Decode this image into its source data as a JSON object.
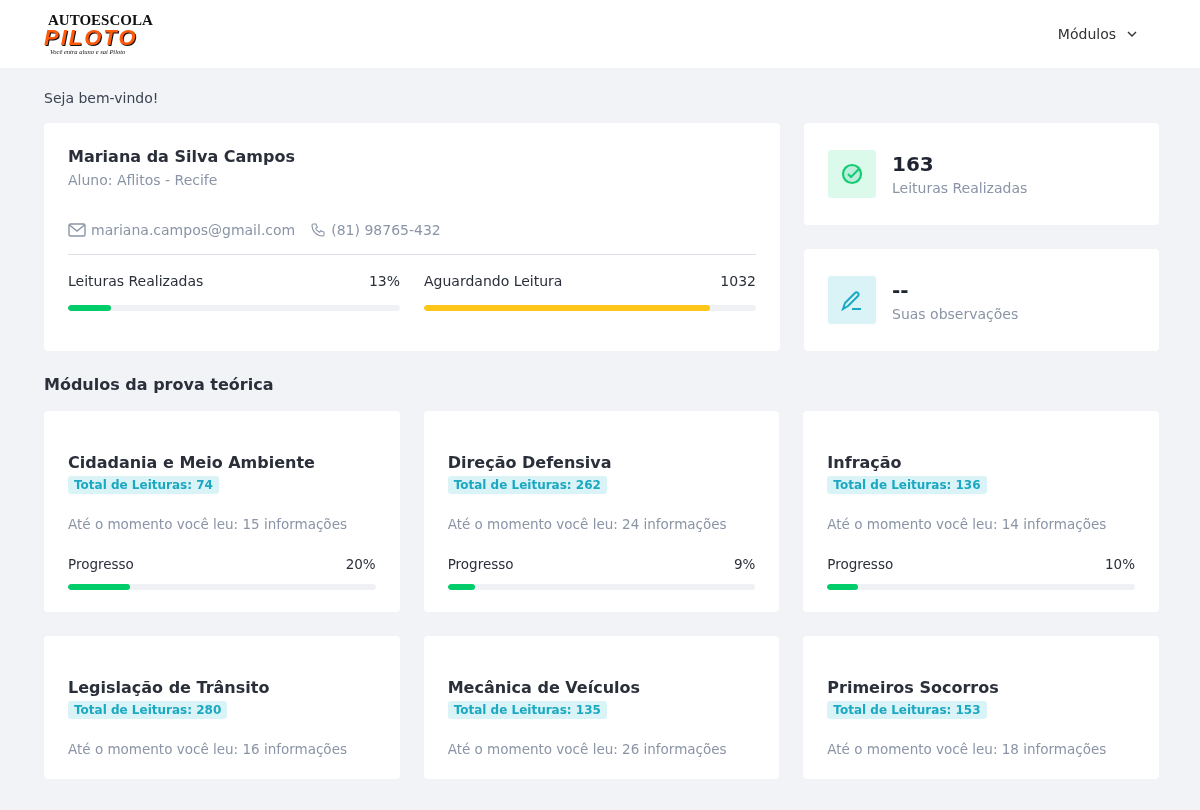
{
  "logo": {
    "top": "AUTOESCOLA",
    "brand": "PILOTO",
    "slogan": "Você entra  aluno e sai Piloto"
  },
  "nav": {
    "label": "Módulos"
  },
  "welcome": "Seja bem-vindo!",
  "profile": {
    "name": "Mariana da Silva Campos",
    "subtitle": "Aluno: Aflitos - Recife",
    "email": "mariana.campos@gmail.com",
    "phone": "(81) 98765-432",
    "stats": [
      {
        "label": "Leituras Realizadas",
        "value": "13%",
        "level": 0.13,
        "color": "#00cc6a"
      },
      {
        "label": "Aguardando Leitura",
        "value": "1032",
        "level": 0.86,
        "color": "#ffc61a"
      }
    ]
  },
  "summary": [
    {
      "kind": "check",
      "value": "163",
      "label": "Leituras Realizadas"
    },
    {
      "kind": "pen",
      "value": "--",
      "label": "Suas observações"
    }
  ],
  "modules_title": "Módulos da prova teórica",
  "modules": [
    {
      "title": "Cidadania e Meio Ambiente",
      "badge": "Total de Leituras: 74",
      "text": "Até o momento você leu: 15 informações",
      "progress_label": "Progresso",
      "percent": "20%",
      "level": 0.2
    },
    {
      "title": "Direção Defensiva",
      "badge": "Total de Leituras: 262",
      "text": "Até o momento você leu: 24 informações",
      "progress_label": "Progresso",
      "percent": "9%",
      "level": 0.09
    },
    {
      "title": "Infração",
      "badge": "Total de Leituras: 136",
      "text": "Até o momento você leu: 14 informações",
      "progress_label": "Progresso",
      "percent": "10%",
      "level": 0.1
    },
    {
      "title": "Legislação de Trânsito",
      "badge": "Total de Leituras: 280",
      "text": "Até o momento você leu: 16 informações"
    },
    {
      "title": "Mecânica de Veículos",
      "badge": "Total de Leituras: 135",
      "text": "Até o momento você leu: 26 informações"
    },
    {
      "title": "Primeiros Socorros",
      "badge": "Total de Leituras: 153",
      "text": "Até o momento você leu: 18 informações"
    }
  ]
}
